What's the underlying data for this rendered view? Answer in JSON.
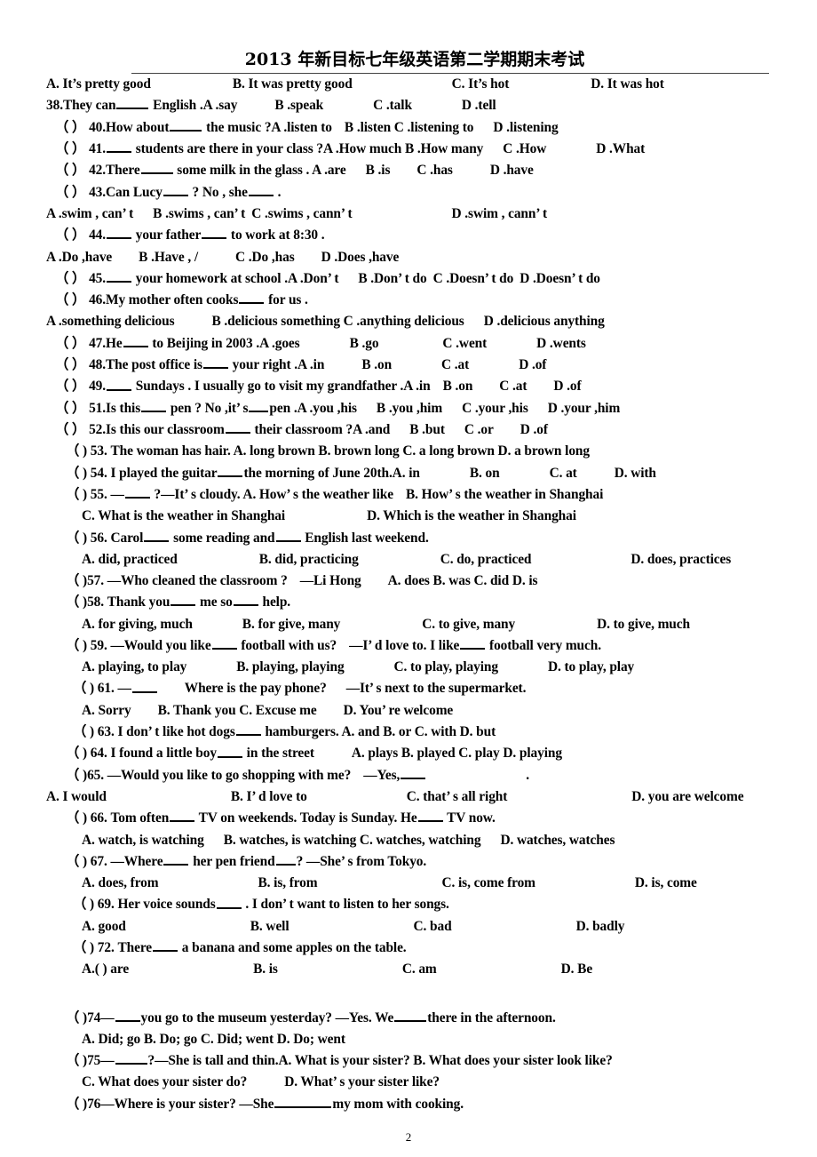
{
  "document": {
    "title": "2013 年新目标七年级英语第二学期期末考试",
    "page_number": "2"
  },
  "lines": [
    {
      "id": "opt-37",
      "indent": "i0",
      "parts": [
        {
          "t": "A.  It’s pretty good"
        },
        {
          "sp": "sp8"
        },
        {
          "t": "B.  It was pretty good"
        },
        {
          "sp": "sp9"
        },
        {
          "t": "C.  It’s hot"
        },
        {
          "sp": "sp8"
        },
        {
          "t": "D.  It was hot"
        }
      ]
    },
    {
      "id": "q-38",
      "indent": "i0",
      "parts": [
        {
          "t": "38.They can"
        },
        {
          "blank": "b-lg"
        },
        {
          "t": " English .A .say"
        },
        {
          "sp": "sp5"
        },
        {
          "t": "B .speak"
        },
        {
          "sp": "sp6"
        },
        {
          "t": "C .talk"
        },
        {
          "sp": "sp6"
        },
        {
          "t": "D .tell"
        }
      ]
    },
    {
      "id": "q-40",
      "indent": "i2",
      "parts": [
        {
          "t": "（   ） 40.How about"
        },
        {
          "blank": "b-lg"
        },
        {
          "t": " the music ?A .listen to"
        },
        {
          "sp": "sp2"
        },
        {
          "t": "B .listen C .listening to"
        },
        {
          "sp": "sp3"
        },
        {
          "t": "D .listening"
        }
      ]
    },
    {
      "id": "q-41",
      "indent": "i2",
      "parts": [
        {
          "t": "（   ） 41."
        },
        {
          "blank": "b-md"
        },
        {
          "t": " students are there in your class ?A .How much B .How many"
        },
        {
          "sp": "sp3"
        },
        {
          "t": "C .How"
        },
        {
          "sp": "sp6"
        },
        {
          "t": "D .What"
        }
      ]
    },
    {
      "id": "q-42",
      "indent": "i2",
      "parts": [
        {
          "t": "（   ） 42.There"
        },
        {
          "blank": "b-lg"
        },
        {
          "t": " some milk in the glass . A .are"
        },
        {
          "sp": "sp3"
        },
        {
          "t": "B .is"
        },
        {
          "sp": "sp4"
        },
        {
          "t": "C .has"
        },
        {
          "sp": "sp5"
        },
        {
          "t": "D .have"
        }
      ]
    },
    {
      "id": "q-43",
      "indent": "i2",
      "parts": [
        {
          "t": "（   ） 43.Can Lucy"
        },
        {
          "blank": "b-md"
        },
        {
          "t": " ? No , she"
        },
        {
          "blank": "b-md"
        },
        {
          "t": " ."
        }
      ]
    },
    {
      "id": "opt-43",
      "indent": "i0",
      "parts": [
        {
          "t": "A .swim , can’ t"
        },
        {
          "sp": "sp3"
        },
        {
          "t": "B .swims , can’ t"
        },
        {
          "sp": "sp1"
        },
        {
          "t": "C .swims , cann’ t"
        },
        {
          "sp": "sp9"
        },
        {
          "t": "D .swim , cann’ t"
        }
      ]
    },
    {
      "id": "q-44",
      "indent": "i2",
      "parts": [
        {
          "t": "（   ） 44."
        },
        {
          "blank": "b-md"
        },
        {
          "t": " your father"
        },
        {
          "blank": "b-md"
        },
        {
          "t": " to work at 8:30 ."
        }
      ]
    },
    {
      "id": "opt-44",
      "indent": "i0",
      "parts": [
        {
          "t": "A .Do ,have"
        },
        {
          "sp": "sp4"
        },
        {
          "t": "B .Have , /"
        },
        {
          "sp": "sp5"
        },
        {
          "t": "C .Do ,has"
        },
        {
          "sp": "sp4"
        },
        {
          "t": "D .Does ,have"
        }
      ]
    },
    {
      "id": "q-45",
      "indent": "i2",
      "parts": [
        {
          "t": "（   ） 45."
        },
        {
          "blank": "b-md"
        },
        {
          "t": " your homework at school .A .Don’ t"
        },
        {
          "sp": "sp3"
        },
        {
          "t": "B .Don’ t do"
        },
        {
          "sp": "sp1"
        },
        {
          "t": "C .Doesn’ t do"
        },
        {
          "sp": "sp1"
        },
        {
          "t": "D .Doesn’ t do"
        }
      ]
    },
    {
      "id": "q-46",
      "indent": "i2",
      "parts": [
        {
          "t": "（   ） 46.My mother often cooks"
        },
        {
          "blank": "b-md"
        },
        {
          "t": " for us ."
        }
      ]
    },
    {
      "id": "opt-46",
      "indent": "i0",
      "parts": [
        {
          "t": "A .something delicious"
        },
        {
          "sp": "sp5"
        },
        {
          "t": "B .delicious something C .anything delicious"
        },
        {
          "sp": "sp3"
        },
        {
          "t": "D .delicious anything"
        }
      ]
    },
    {
      "id": "q-47",
      "indent": "i2",
      "parts": [
        {
          "t": "（   ） 47.He"
        },
        {
          "blank": "b-md"
        },
        {
          "t": " to Beijing in 2003 .A .goes"
        },
        {
          "sp": "sp6"
        },
        {
          "t": "B .go"
        },
        {
          "sp": "sp7"
        },
        {
          "t": "C .went"
        },
        {
          "sp": "sp6"
        },
        {
          "t": "D .wents"
        }
      ]
    },
    {
      "id": "q-48",
      "indent": "i2",
      "parts": [
        {
          "t": "（   ） 48.The post office is"
        },
        {
          "blank": "b-md"
        },
        {
          "t": " your right .A .in"
        },
        {
          "sp": "sp5"
        },
        {
          "t": "B .on"
        },
        {
          "sp": "sp6"
        },
        {
          "t": "C .at"
        },
        {
          "sp": "sp6"
        },
        {
          "t": "D .of"
        }
      ]
    },
    {
      "id": "q-49",
      "indent": "i2",
      "parts": [
        {
          "t": "（   ） 49."
        },
        {
          "blank": "b-md"
        },
        {
          "t": " Sundays . I usually go to visit my grandfather .A .in"
        },
        {
          "sp": "sp2"
        },
        {
          "t": "B .on"
        },
        {
          "sp": "sp4"
        },
        {
          "t": "C .at"
        },
        {
          "sp": "sp4"
        },
        {
          "t": "D .of"
        }
      ]
    },
    {
      "id": "q-51",
      "indent": "i2",
      "parts": [
        {
          "t": "（   ） 51.Is this"
        },
        {
          "blank": "b-md"
        },
        {
          "t": " pen ? No ,it’ s"
        },
        {
          "blank": "b-sm"
        },
        {
          "t": "pen .A .you ,his"
        },
        {
          "sp": "sp3"
        },
        {
          "t": "B .you ,him"
        },
        {
          "sp": "sp3"
        },
        {
          "t": "C .your ,his"
        },
        {
          "sp": "sp3"
        },
        {
          "t": "D .your ,him"
        }
      ]
    },
    {
      "id": "q-52",
      "indent": "i2",
      "parts": [
        {
          "t": "（   ） 52.Is this our classroom"
        },
        {
          "blank": "b-md"
        },
        {
          "t": " their classroom ?A .and"
        },
        {
          "sp": "sp3"
        },
        {
          "t": "B .but"
        },
        {
          "sp": "sp3"
        },
        {
          "t": "C .or"
        },
        {
          "sp": "sp4"
        },
        {
          "t": "D .of"
        }
      ]
    },
    {
      "id": "q-53",
      "indent": "i4",
      "parts": [
        {
          "t": "（  ) 53. The   woman has    hair. A. long brown B. brown long C. a long brown D. a brown long"
        }
      ]
    },
    {
      "id": "q-54",
      "indent": "i4",
      "parts": [
        {
          "t": "（  ) 54. I played the guitar"
        },
        {
          "blank": "b-md"
        },
        {
          "t": "the morning of June 20th.A. in"
        },
        {
          "sp": "sp6"
        },
        {
          "t": "B. on"
        },
        {
          "sp": "sp6"
        },
        {
          "t": "C. at"
        },
        {
          "sp": "sp5"
        },
        {
          "t": "D. with"
        }
      ]
    },
    {
      "id": "q-55",
      "indent": "i4",
      "parts": [
        {
          "t": "（  ) 55. —"
        },
        {
          "blank": "b-md"
        },
        {
          "t": " ?—It’ s cloudy. A. How’ s the weather like"
        },
        {
          "sp": "sp2"
        },
        {
          "t": "B. How’ s the weather in Shanghai"
        }
      ]
    },
    {
      "id": "opt-55",
      "indent": "i6",
      "parts": [
        {
          "t": "C. What is the weather in Shanghai"
        },
        {
          "sp": "sp8"
        },
        {
          "t": "D. Which is the weather in Shanghai"
        }
      ]
    },
    {
      "id": "q-56",
      "indent": "i4",
      "parts": [
        {
          "t": "（  ) 56. Carol"
        },
        {
          "blank": "b-md"
        },
        {
          "t": " some reading and"
        },
        {
          "blank": "b-md"
        },
        {
          "t": " English last weekend."
        }
      ]
    },
    {
      "id": "opt-56",
      "indent": "i6",
      "parts": [
        {
          "t": "A. did, practiced"
        },
        {
          "sp": "sp8"
        },
        {
          "t": "B. did, practicing"
        },
        {
          "sp": "sp8"
        },
        {
          "t": "C. do, practiced"
        },
        {
          "sp": "sp9"
        },
        {
          "t": "D. does, practices"
        }
      ]
    },
    {
      "id": "q-57",
      "indent": "i4",
      "parts": [
        {
          "t": "（  )57. —Who cleaned the classroom ?"
        },
        {
          "sp": "sp2"
        },
        {
          "t": "—Li Hong"
        },
        {
          "sp": "sp4"
        },
        {
          "t": "A. does  B. was  C. did   D. is"
        }
      ]
    },
    {
      "id": "q-58",
      "indent": "i4",
      "parts": [
        {
          "t": "（  )58. Thank you"
        },
        {
          "blank": "b-md"
        },
        {
          "t": " me so"
        },
        {
          "blank": "b-md"
        },
        {
          "t": " help."
        }
      ]
    },
    {
      "id": "opt-58",
      "indent": "i6",
      "parts": [
        {
          "t": "A. for giving, much"
        },
        {
          "sp": "sp6"
        },
        {
          "t": "B. for give, many"
        },
        {
          "sp": "sp8"
        },
        {
          "t": "C. to give, many"
        },
        {
          "sp": "sp8"
        },
        {
          "t": "D. to give, much"
        }
      ]
    },
    {
      "id": "q-59",
      "indent": "i4",
      "parts": [
        {
          "t": "（  ) 59. —Would you like"
        },
        {
          "blank": "b-md"
        },
        {
          "t": " football with us?"
        },
        {
          "sp": "sp2"
        },
        {
          "t": "—I’ d love to. I like"
        },
        {
          "blank": "b-md"
        },
        {
          "t": " football very much."
        }
      ]
    },
    {
      "id": "opt-59",
      "indent": "i6",
      "parts": [
        {
          "t": "A. playing, to play"
        },
        {
          "sp": "sp6"
        },
        {
          "t": "B. playing, playing"
        },
        {
          "sp": "sp6"
        },
        {
          "t": "C. to play, playing"
        },
        {
          "sp": "sp6"
        },
        {
          "t": "D. to play, play"
        }
      ]
    },
    {
      "id": "q-61",
      "indent": "i5",
      "parts": [
        {
          "t": "（  ) 61. —"
        },
        {
          "blank": "b-md"
        },
        {
          "sp": "sp4"
        },
        {
          "t": "Where is the pay phone?"
        },
        {
          "sp": "sp3"
        },
        {
          "t": "—It’ s next to the supermarket."
        }
      ]
    },
    {
      "id": "opt-61",
      "indent": "i6",
      "parts": [
        {
          "t": "A. Sorry"
        },
        {
          "sp": "sp4"
        },
        {
          "t": "B. Thank you  C. Excuse me"
        },
        {
          "sp": "sp4"
        },
        {
          "t": "D. You’ re welcome"
        }
      ]
    },
    {
      "id": "q-63",
      "indent": "i5",
      "parts": [
        {
          "t": "（  ) 63. I don’ t like hot dogs"
        },
        {
          "blank": "b-md"
        },
        {
          "t": "  hamburgers.  A. and  B. or  C. with  D. but"
        }
      ]
    },
    {
      "id": "q-64",
      "indent": "i4",
      "parts": [
        {
          "t": "（  ) 64. I found a little boy"
        },
        {
          "blank": "b-md"
        },
        {
          "t": " in the street"
        },
        {
          "sp": "sp5"
        },
        {
          "t": "A. plays B. played   C. play   D. playing"
        }
      ]
    },
    {
      "id": "q-65",
      "indent": "i4",
      "parts": [
        {
          "t": "（  )65. —Would you like to go shopping with me?"
        },
        {
          "sp": "sp2"
        },
        {
          "t": "—Yes,"
        },
        {
          "blank": "b-md"
        },
        {
          "sp": "sp9"
        },
        {
          "t": "."
        }
      ]
    },
    {
      "id": "opt-65",
      "indent": "i0",
      "parts": [
        {
          "t": "A. I would"
        },
        {
          "sp": "sp10"
        },
        {
          "t": "B. I’ d love to"
        },
        {
          "sp": "sp9"
        },
        {
          "t": "C. that’ s all right"
        },
        {
          "sp": "sp10"
        },
        {
          "t": "D. you are welcome"
        }
      ]
    },
    {
      "id": "q-66",
      "indent": "i4",
      "parts": [
        {
          "t": "（  ) 66. Tom often"
        },
        {
          "blank": "b-md"
        },
        {
          "t": " TV on weekends. Today is Sunday. He"
        },
        {
          "blank": "b-md"
        },
        {
          "t": " TV now."
        }
      ]
    },
    {
      "id": "opt-66",
      "indent": "i6",
      "parts": [
        {
          "t": "A. watch, is watching"
        },
        {
          "sp": "sp3"
        },
        {
          "t": "B. watches, is watching C. watches, watching"
        },
        {
          "sp": "sp3"
        },
        {
          "t": "D. watches, watches"
        }
      ]
    },
    {
      "id": "q-67",
      "indent": "i4",
      "parts": [
        {
          "t": "（  ) 67. —Where"
        },
        {
          "blank": "b-md"
        },
        {
          "t": " her pen friend"
        },
        {
          "blank": "b-sm"
        },
        {
          "t": "? —She’ s from Tokyo."
        }
      ]
    },
    {
      "id": "opt-67",
      "indent": "i6",
      "parts": [
        {
          "t": "A. does, from"
        },
        {
          "sp": "sp9"
        },
        {
          "t": "B. is, from"
        },
        {
          "sp": "sp10"
        },
        {
          "t": "C. is, come from"
        },
        {
          "sp": "sp9"
        },
        {
          "t": "D. is, come"
        }
      ]
    },
    {
      "id": "q-69",
      "indent": "i5",
      "parts": [
        {
          "t": "（  ) 69. Her voice sounds"
        },
        {
          "blank": "b-md"
        },
        {
          "t": " . I don’ t want to listen to her songs."
        }
      ]
    },
    {
      "id": "opt-69",
      "indent": "i6",
      "parts": [
        {
          "t": "A. good"
        },
        {
          "sp": "sp10"
        },
        {
          "t": "B. well"
        },
        {
          "sp": "sp10"
        },
        {
          "t": "C. bad"
        },
        {
          "sp": "sp10"
        },
        {
          "t": "D. badly"
        }
      ]
    },
    {
      "id": "q-72",
      "indent": "i5",
      "parts": [
        {
          "t": "（  ) 72. There"
        },
        {
          "blank": "b-md"
        },
        {
          "t": " a banana and some apples on the table."
        }
      ]
    },
    {
      "id": "opt-72",
      "indent": "i6",
      "parts": [
        {
          "t": "A.(   ) are"
        },
        {
          "sp": "sp10"
        },
        {
          "t": "B. is"
        },
        {
          "sp": "sp10"
        },
        {
          "t": "C. am"
        },
        {
          "sp": "sp10"
        },
        {
          "t": "D. Be"
        }
      ]
    },
    {
      "id": "q-74",
      "indent": "i4",
      "gap_before": true,
      "parts": [
        {
          "t": "（  )74—"
        },
        {
          "blank": "b-md"
        },
        {
          "t": "you go to the museum yesterday?  —Yes. We"
        },
        {
          "blank": "b-lg"
        },
        {
          "t": "there in the afternoon."
        }
      ]
    },
    {
      "id": "opt-74",
      "indent": "i6",
      "parts": [
        {
          "t": "A. Did; go   B. Do; go    C. Did; went    D. Do; went"
        }
      ]
    },
    {
      "id": "q-75",
      "indent": "i4",
      "parts": [
        {
          "t": "（  )75—"
        },
        {
          "blank": "b-lg"
        },
        {
          "t": "?—She is tall and thin.A. What is your sister?  B. What does your sister look like?"
        }
      ]
    },
    {
      "id": "opt-75",
      "indent": "i6",
      "parts": [
        {
          "t": "C. What does your sister do?"
        },
        {
          "sp": "sp5"
        },
        {
          "t": "D. What’ s your sister like?"
        }
      ]
    },
    {
      "id": "q-76",
      "indent": "i4",
      "parts": [
        {
          "t": "（  )76—Where is your sister?  —She"
        },
        {
          "blank": "b-xxl"
        },
        {
          "t": "my mom with cooking."
        }
      ]
    }
  ]
}
